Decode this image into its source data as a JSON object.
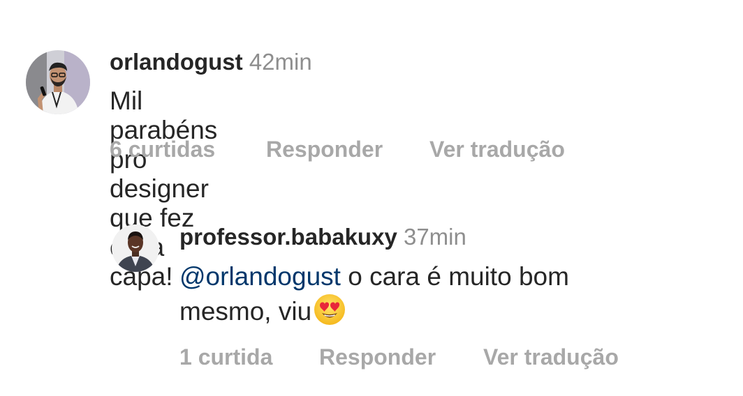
{
  "comments": [
    {
      "username": "orlandogust",
      "time": "42min",
      "text": "Mil parabéns pro designer que fez essa capa!",
      "likes": "6 curtidas",
      "reply_label": "Responder",
      "translate_label": "Ver tradução",
      "avatar_icon": "avatar-photo-speaker-with-microphone"
    },
    {
      "username": "professor.babakuxy",
      "time": "37min",
      "mention": "@orlandogust",
      "text_line1": "o cara é muito bom",
      "text_line2": "mesmo, viu",
      "emoji_icon": "heart-eyes-emoji-icon",
      "likes": "1 curtida",
      "reply_label": "Responder",
      "translate_label": "Ver tradução",
      "avatar_icon": "avatar-photo-man-in-suit"
    }
  ],
  "colors": {
    "text": "#262626",
    "secondary": "#8e8e8e",
    "actions": "#a8a8a8",
    "mention": "#00376b"
  }
}
